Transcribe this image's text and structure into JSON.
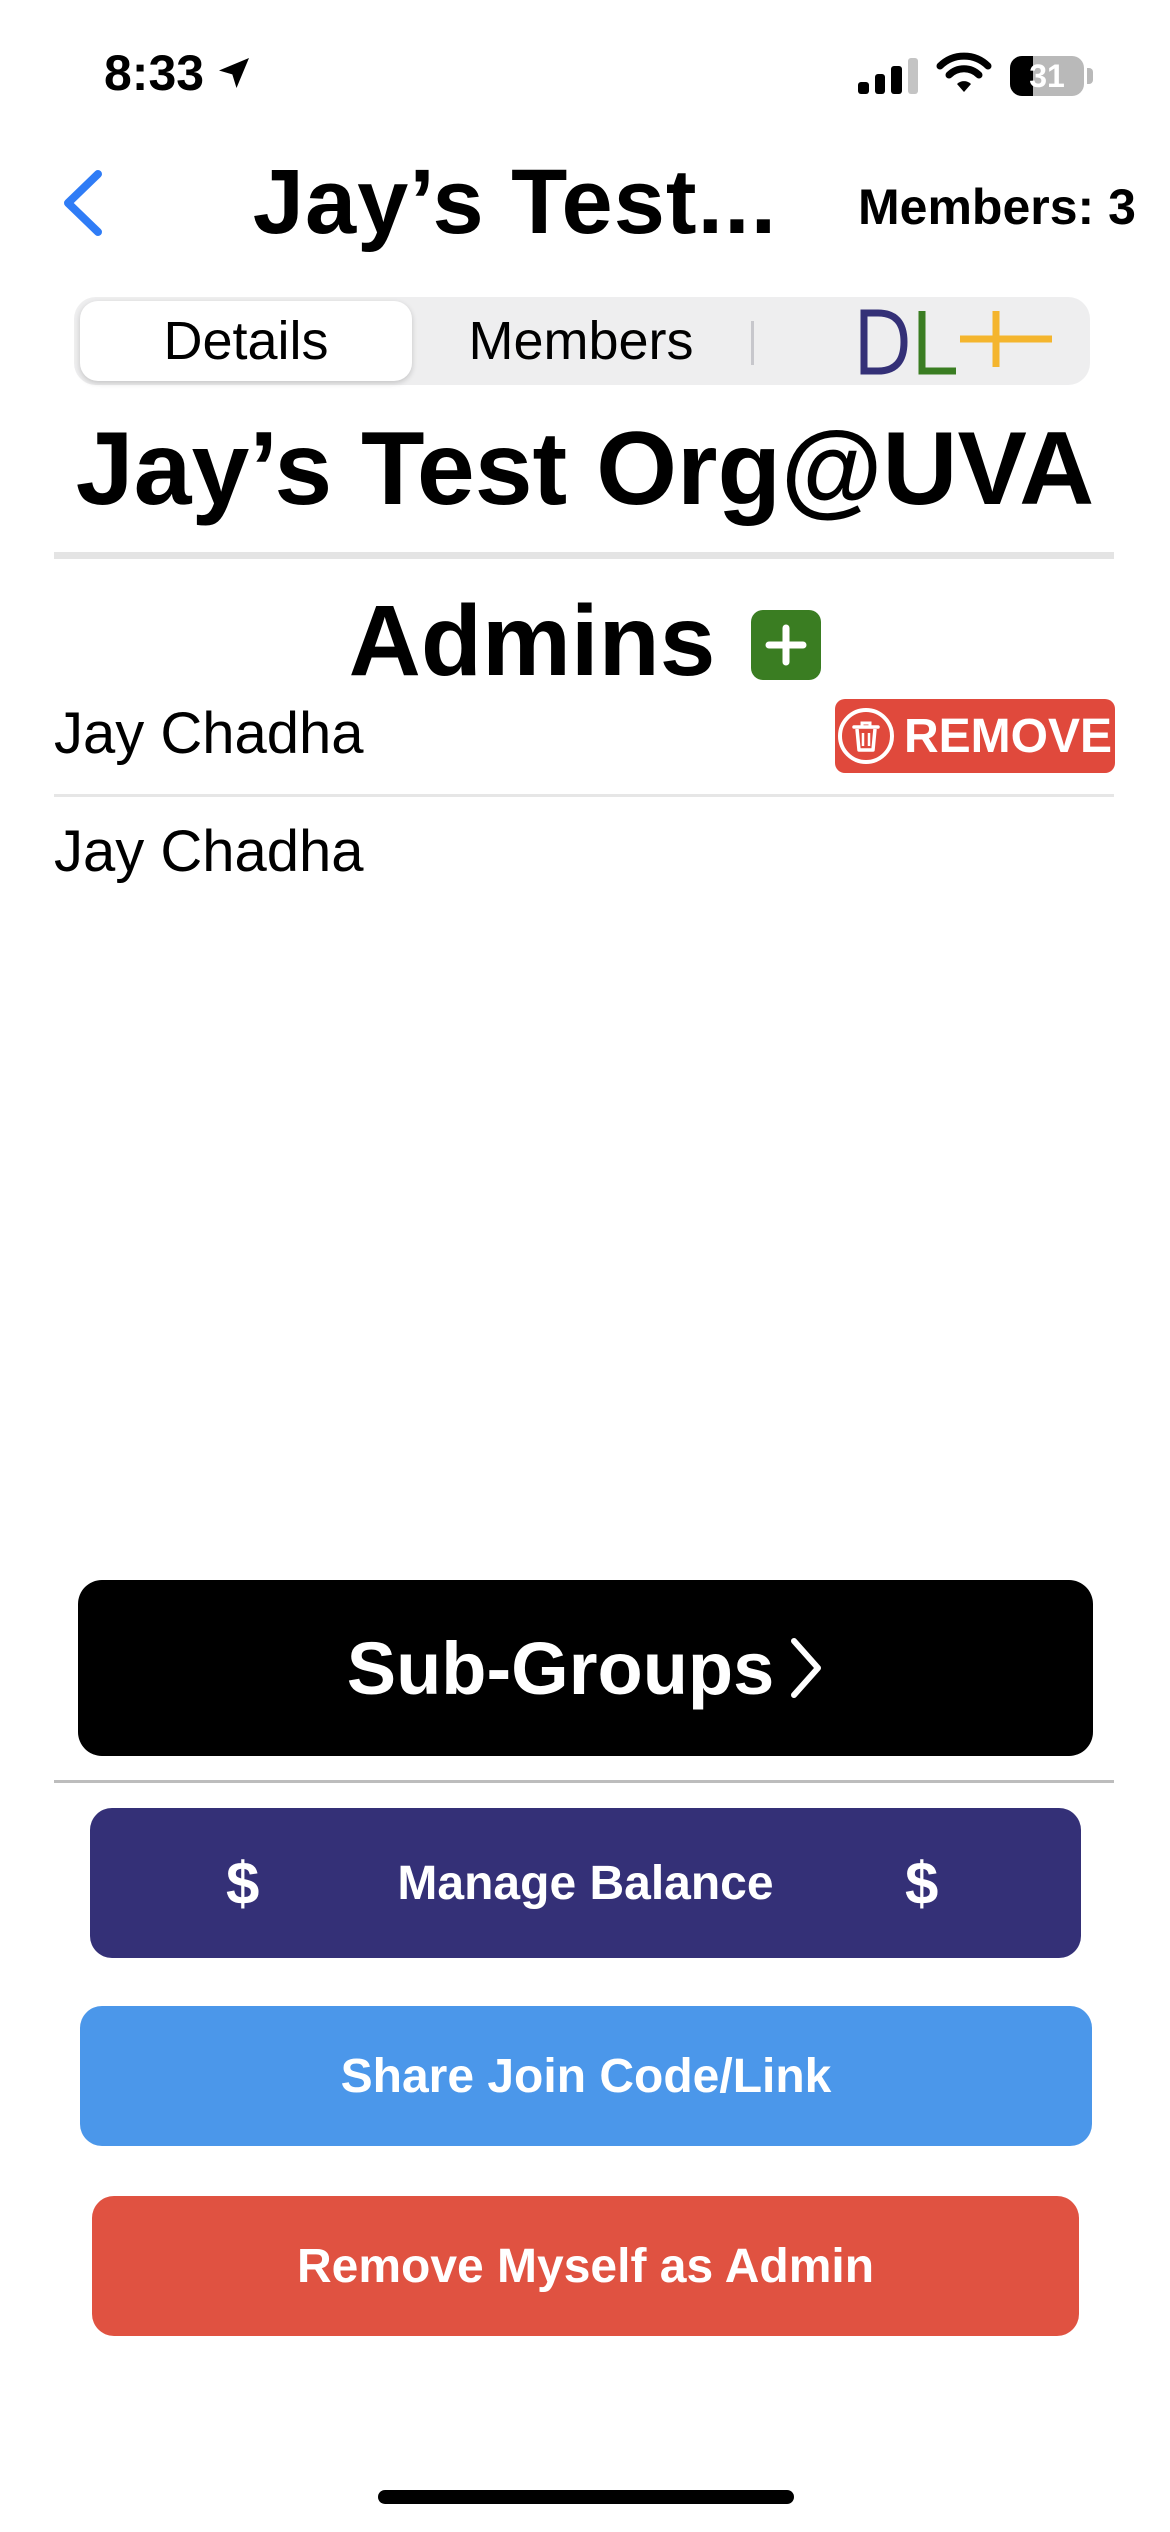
{
  "status_bar": {
    "time": "8:33",
    "battery": "31",
    "battery_level": 0.31
  },
  "nav": {
    "title": "Jay’s Test...",
    "members_count": "Members: 3"
  },
  "segments": {
    "details": "Details",
    "members": "Members",
    "logo_letters": [
      "D",
      "L",
      "+"
    ]
  },
  "org_name": "Jay’s Test Org@UVA",
  "admins": {
    "title": "Admins",
    "list": [
      {
        "name": "Jay Chadha",
        "action": "REMOVE"
      },
      {
        "name": "Jay Chadha"
      }
    ]
  },
  "buttons": {
    "subgroups": "Sub-Groups",
    "manage_balance": "Manage Balance",
    "dollar": "$",
    "share": "Share Join Code/Link",
    "remove_self": "Remove Myself as Admin"
  },
  "colors": {
    "accent_blue": "#2f7cf6",
    "add_green": "#3a7d22",
    "remove_red": "#e0493c",
    "manage_navy": "#343077",
    "share_blue": "#4b97ea",
    "logo_d": "#343077",
    "logo_l": "#3a7d22",
    "logo_plus": "#f4b52e"
  },
  "icons": [
    "location-arrow-icon",
    "signal-icon",
    "wifi-icon",
    "battery-icon",
    "back-chevron-icon",
    "plus-icon",
    "trash-icon",
    "chevron-right-icon"
  ]
}
